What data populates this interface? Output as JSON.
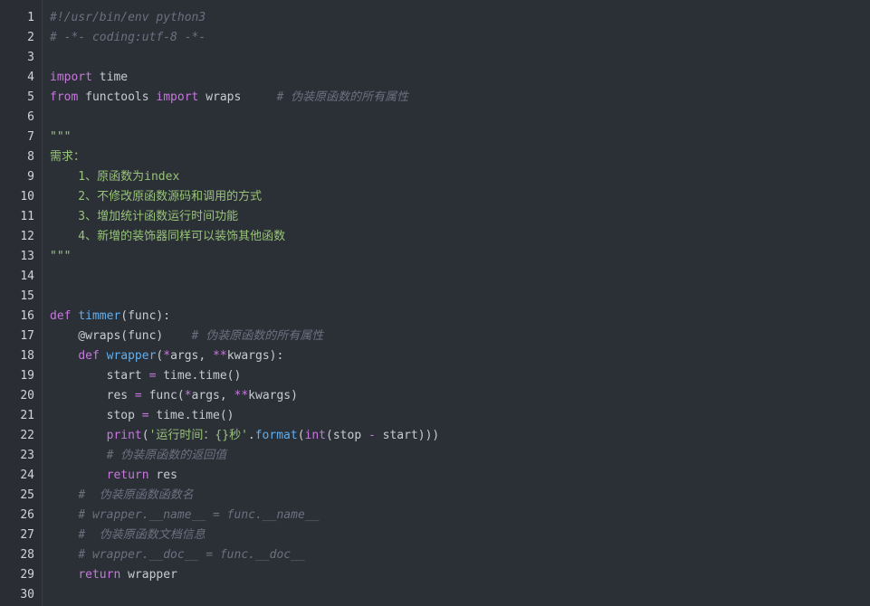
{
  "editor": {
    "language": "python",
    "lines": [
      [
        {
          "t": "cm",
          "v": "#!/usr/bin/env python3"
        }
      ],
      [
        {
          "t": "cm",
          "v": "# -*- coding:utf-8 -*-"
        }
      ],
      [],
      [
        {
          "t": "kw",
          "v": "import"
        },
        {
          "t": "tx",
          "v": " time"
        }
      ],
      [
        {
          "t": "kw",
          "v": "from"
        },
        {
          "t": "tx",
          "v": " functools "
        },
        {
          "t": "kw",
          "v": "import"
        },
        {
          "t": "tx",
          "v": " wraps     "
        },
        {
          "t": "cm",
          "v": "# 伪装原函数的所有属性"
        }
      ],
      [],
      [
        {
          "t": "st",
          "v": "\"\"\""
        }
      ],
      [
        {
          "t": "st",
          "v": "需求："
        }
      ],
      [
        {
          "t": "st",
          "v": "    1、原函数为index"
        }
      ],
      [
        {
          "t": "st",
          "v": "    2、不修改原函数源码和调用的方式"
        }
      ],
      [
        {
          "t": "st",
          "v": "    3、增加统计函数运行时间功能"
        }
      ],
      [
        {
          "t": "st",
          "v": "    4、新增的装饰器同样可以装饰其他函数"
        }
      ],
      [
        {
          "t": "st",
          "v": "\"\"\""
        }
      ],
      [],
      [],
      [
        {
          "t": "kw",
          "v": "def"
        },
        {
          "t": "tx",
          "v": " "
        },
        {
          "t": "fn",
          "v": "timmer"
        },
        {
          "t": "tx",
          "v": "(func):"
        }
      ],
      [
        {
          "t": "tx",
          "v": "    @wraps(func)    "
        },
        {
          "t": "cm",
          "v": "# 伪装原函数的所有属性"
        }
      ],
      [
        {
          "t": "tx",
          "v": "    "
        },
        {
          "t": "kw",
          "v": "def"
        },
        {
          "t": "tx",
          "v": " "
        },
        {
          "t": "fn",
          "v": "wrapper"
        },
        {
          "t": "tx",
          "v": "("
        },
        {
          "t": "op",
          "v": "*"
        },
        {
          "t": "tx",
          "v": "args, "
        },
        {
          "t": "op",
          "v": "**"
        },
        {
          "t": "tx",
          "v": "kwargs):"
        }
      ],
      [
        {
          "t": "tx",
          "v": "        start "
        },
        {
          "t": "op",
          "v": "="
        },
        {
          "t": "tx",
          "v": " time.time()"
        }
      ],
      [
        {
          "t": "tx",
          "v": "        res "
        },
        {
          "t": "op",
          "v": "="
        },
        {
          "t": "tx",
          "v": " func("
        },
        {
          "t": "op",
          "v": "*"
        },
        {
          "t": "tx",
          "v": "args, "
        },
        {
          "t": "op",
          "v": "**"
        },
        {
          "t": "tx",
          "v": "kwargs)"
        }
      ],
      [
        {
          "t": "tx",
          "v": "        stop "
        },
        {
          "t": "op",
          "v": "="
        },
        {
          "t": "tx",
          "v": " time.time()"
        }
      ],
      [
        {
          "t": "tx",
          "v": "        "
        },
        {
          "t": "kw",
          "v": "print"
        },
        {
          "t": "tx",
          "v": "("
        },
        {
          "t": "st",
          "v": "'运行时间：{}秒'"
        },
        {
          "t": "tx",
          "v": "."
        },
        {
          "t": "fn",
          "v": "format"
        },
        {
          "t": "tx",
          "v": "("
        },
        {
          "t": "kw",
          "v": "int"
        },
        {
          "t": "tx",
          "v": "(stop "
        },
        {
          "t": "op",
          "v": "-"
        },
        {
          "t": "tx",
          "v": " start)))"
        }
      ],
      [
        {
          "t": "tx",
          "v": "        "
        },
        {
          "t": "cm",
          "v": "# 伪装原函数的返回值"
        }
      ],
      [
        {
          "t": "tx",
          "v": "        "
        },
        {
          "t": "kw",
          "v": "return"
        },
        {
          "t": "tx",
          "v": " res"
        }
      ],
      [
        {
          "t": "tx",
          "v": "    "
        },
        {
          "t": "cm",
          "v": "#  伪装原函数函数名"
        }
      ],
      [
        {
          "t": "tx",
          "v": "    "
        },
        {
          "t": "cm",
          "v": "# wrapper.__name__ = func.__name__"
        }
      ],
      [
        {
          "t": "tx",
          "v": "    "
        },
        {
          "t": "cm",
          "v": "#  伪装原函数文档信息"
        }
      ],
      [
        {
          "t": "tx",
          "v": "    "
        },
        {
          "t": "cm",
          "v": "# wrapper.__doc__ = func.__doc__"
        }
      ],
      [
        {
          "t": "tx",
          "v": "    "
        },
        {
          "t": "kw",
          "v": "return"
        },
        {
          "t": "tx",
          "v": " wrapper"
        }
      ],
      []
    ],
    "line_numbers": [
      "1",
      "2",
      "3",
      "4",
      "5",
      "6",
      "7",
      "8",
      "9",
      "10",
      "11",
      "12",
      "13",
      "14",
      "15",
      "16",
      "17",
      "18",
      "19",
      "20",
      "21",
      "22",
      "23",
      "24",
      "25",
      "26",
      "27",
      "28",
      "29",
      "30"
    ]
  },
  "colors": {
    "background": "#2b2f36",
    "keyword": "#c678dd",
    "function": "#61afef",
    "comment": "#6a7280",
    "string": "#98c379",
    "text": "#c8ccd2"
  }
}
